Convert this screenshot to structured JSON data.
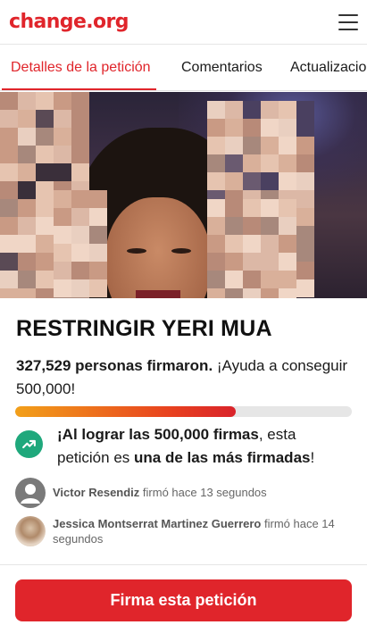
{
  "header": {
    "logo_text": "change.org",
    "brand_color": "#e0252b",
    "menu_icon": "hamburger-menu-icon"
  },
  "tabs": [
    {
      "label": "Detalles de la petición",
      "active": true
    },
    {
      "label": "Comentarios",
      "active": false
    },
    {
      "label": "Actualizaciones",
      "active": false
    }
  ],
  "hero": {
    "image": "photo of a woman with tongue out, hands pixelated"
  },
  "petition": {
    "title": "RESTRINGIR YERI MUA",
    "signers_bold": "327,529 personas firmaron.",
    "signers_rest": " ¡Ayuda a conseguir 500,000!",
    "progress_fraction": 0.655,
    "milestone": {
      "icon": "trending-up-icon",
      "part1": "¡Al lograr las 500,000 firmas",
      "part2": ", esta petición es ",
      "part3": "una de las más firmadas",
      "part4": "!"
    }
  },
  "recent_signers": [
    {
      "name": "Victor Resendiz",
      "action": " firmó hace 13 segundos",
      "avatar": "default-user-icon"
    },
    {
      "name": "Jessica Montserrat Martinez Guerrero",
      "action": " firmó hace 14 segundos",
      "avatar": "user-photo"
    }
  ],
  "footer": {
    "sign_button": "Firma esta petición"
  }
}
